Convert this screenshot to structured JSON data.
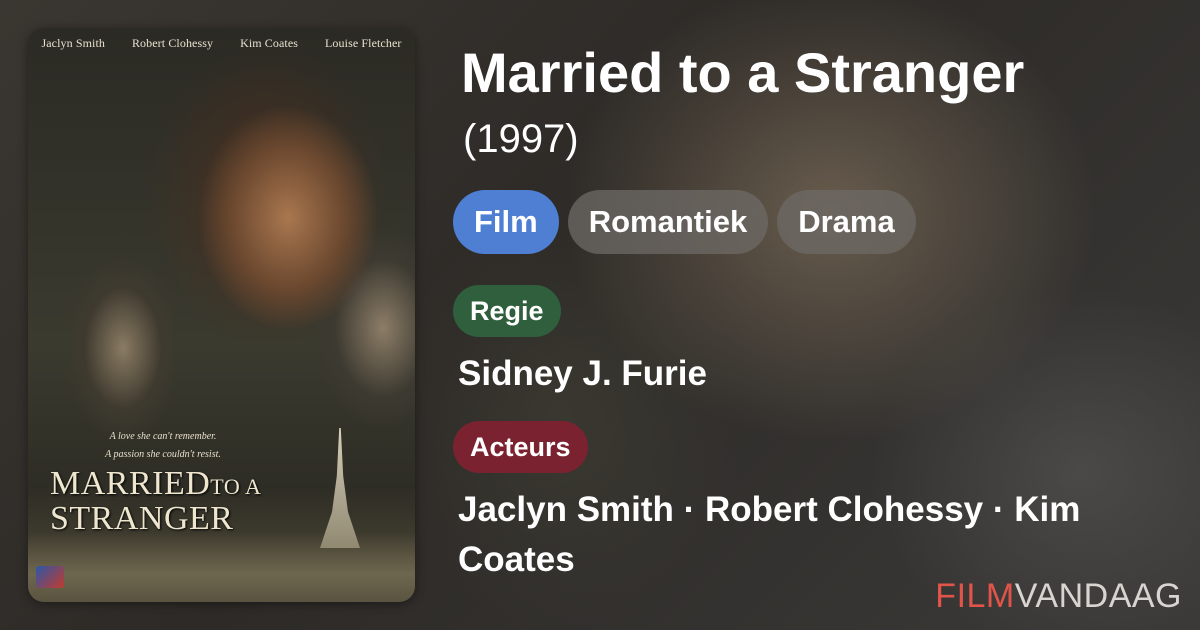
{
  "poster": {
    "cast": [
      "Jaclyn Smith",
      "Robert Clohessy",
      "Kim Coates",
      "Louise Fletcher"
    ],
    "tagline_1": "A love she can't remember.",
    "tagline_2": "A passion she couldn't resist.",
    "title_word_1": "MARRIED",
    "title_word_2": "TO A",
    "title_word_3": "STRANGER"
  },
  "movie": {
    "title": "Married to a Stranger",
    "year": "(1997)",
    "tags": [
      "Film",
      "Romantiek",
      "Drama"
    ],
    "director_label": "Regie",
    "director": "Sidney J. Furie",
    "cast_label": "Acteurs",
    "cast": "Jaclyn Smith · Robert Clohessy · Kim Coates"
  },
  "brand": {
    "part_1": "FILM",
    "part_2": "VANDAAG"
  },
  "colors": {
    "film_tag": "#4f7fd2",
    "genre_tag": "#6e6a66",
    "regie_label": "#2f5f3c",
    "acteurs_label": "#7b2231",
    "brand_accent": "#e0544a"
  }
}
